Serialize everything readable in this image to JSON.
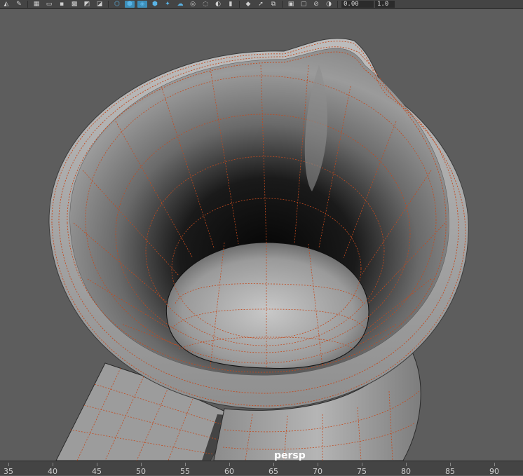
{
  "toolbar": {
    "buttons": [
      {
        "name": "polygon-select-icon",
        "glyph": "◭"
      },
      {
        "name": "pencil-icon",
        "glyph": "✎"
      },
      {
        "name": "grid-icon",
        "glyph": "▦"
      },
      {
        "name": "film-gate-icon",
        "glyph": "▭"
      },
      {
        "name": "resolution-gate-icon",
        "glyph": "▪"
      },
      {
        "name": "field-chart-icon",
        "glyph": "▩"
      },
      {
        "name": "safe-action-icon",
        "glyph": "◩"
      },
      {
        "name": "safe-title-icon",
        "glyph": "◪"
      },
      {
        "name": "wireframe-cube-icon",
        "glyph": "⬡"
      },
      {
        "name": "smooth-shade-cube-icon",
        "glyph": "⬢"
      },
      {
        "name": "wireframe-on-shaded-icon",
        "glyph": "◈"
      },
      {
        "name": "textured-icon",
        "glyph": "⬢"
      },
      {
        "name": "lighting-icon",
        "glyph": "✦"
      },
      {
        "name": "shadows-icon",
        "glyph": "☁"
      },
      {
        "name": "xray-icon",
        "glyph": "◎"
      },
      {
        "name": "xray-joints-icon",
        "glyph": "◌"
      },
      {
        "name": "ambient-occlusion-icon",
        "glyph": "◐"
      },
      {
        "name": "antialias-icon",
        "glyph": "▮"
      },
      {
        "name": "isolate-select-icon",
        "glyph": "◆"
      },
      {
        "name": "cursor-icon",
        "glyph": "➚"
      },
      {
        "name": "copy-icon",
        "glyph": "⧉"
      },
      {
        "name": "paste-icon",
        "glyph": "▣"
      },
      {
        "name": "camera-attributes-icon",
        "glyph": "▢"
      },
      {
        "name": "disable-icon",
        "glyph": "⊘"
      },
      {
        "name": "exposure-icon",
        "glyph": "◑"
      }
    ],
    "highlighted": [
      9,
      10
    ],
    "exposure_value": "0.00",
    "gamma_value": "1.0"
  },
  "viewport": {
    "camera_name": "persp",
    "background_color": "#5d5d5d",
    "wire_color": "#c24a1e"
  },
  "timeline": {
    "ticks": [
      "35",
      "40",
      "45",
      "50",
      "55",
      "60",
      "65",
      "70",
      "75",
      "80",
      "85",
      "90"
    ]
  }
}
